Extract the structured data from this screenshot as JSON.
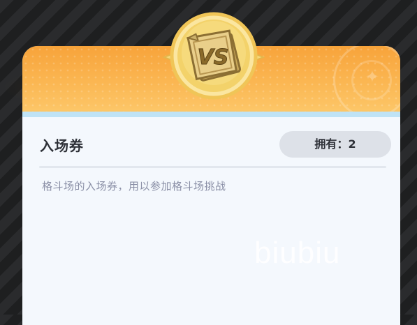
{
  "item": {
    "name": "入场券",
    "owned_label": "拥有：",
    "owned_count": "2",
    "description": "格斗场的入场券，用以参加格斗场挑战",
    "icon": "vs-ticket-icon",
    "icon_text": "VS"
  },
  "watermark": {
    "text": "biubiu"
  },
  "colors": {
    "header_orange": "#f7a33a",
    "header_orange_light": "#fcc86a",
    "card_background": "#f4f8fd",
    "accent_blue": "#bfe3f6",
    "pill_background": "#dde1e8",
    "title_text": "#2e3138",
    "description_text": "#8a8fa6",
    "emblem_gold": "#f2cf63",
    "ticket_brown": "#a88a46"
  }
}
